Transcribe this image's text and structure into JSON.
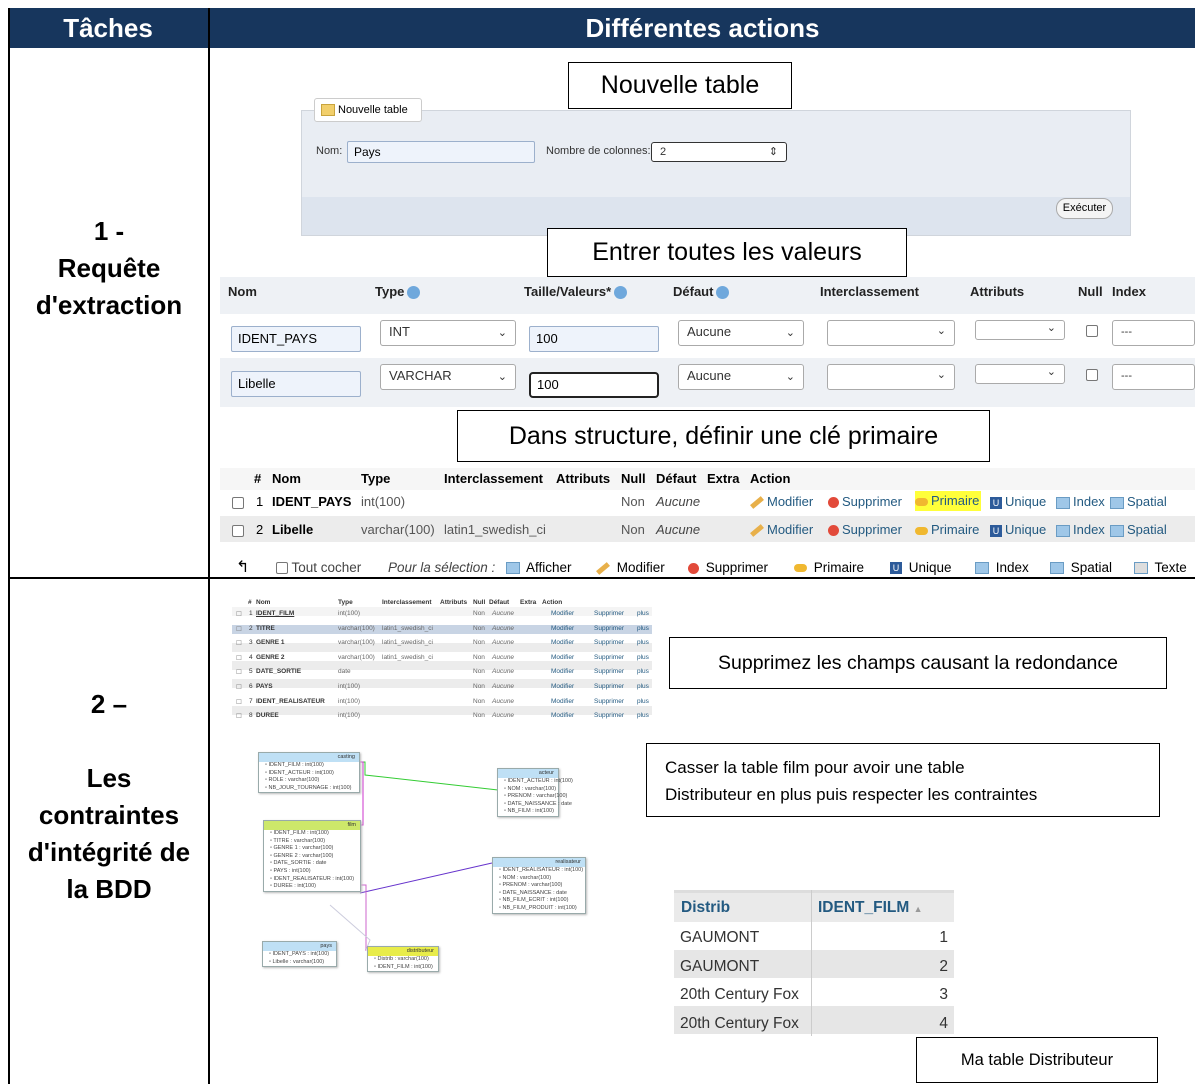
{
  "header": {
    "col1": "Tâches",
    "col2": "Différentes actions"
  },
  "tasks": {
    "task1": [
      "1 -",
      "Requête",
      "d'extraction"
    ],
    "task2": [
      "2 –",
      "",
      "Les",
      "contraintes",
      "d'intégrité de",
      "la BDD"
    ]
  },
  "callouts": {
    "nouvelle_table": "Nouvelle table",
    "entrer_valeurs": "Entrer toutes les valeurs",
    "structure": "Dans structure, définir une clé primaire",
    "supprimez": "Supprimez les champs causant la redondance",
    "casser_l1": "Casser la table film pour avoir une table",
    "casser_l2": "Distributeur en plus puis respecter les contraintes",
    "ma_table": "Ma table Distributeur"
  },
  "new_table_form": {
    "tab_label": "Nouvelle table",
    "nom_label": "Nom:",
    "nom_value": "Pays",
    "cols_label": "Nombre de colonnes:",
    "cols_value": "2",
    "execute": "Exécuter"
  },
  "columns_form": {
    "headers": [
      "Nom",
      "Type",
      "Taille/Valeurs*",
      "Défaut",
      "Interclassement",
      "Attributs",
      "Null",
      "Index"
    ],
    "rows": [
      {
        "name": "IDENT_PAYS",
        "type": "INT",
        "size": "100",
        "default": "Aucune",
        "index": "---"
      },
      {
        "name": "Libelle",
        "type": "VARCHAR",
        "size": "100",
        "default": "Aucune",
        "index": "---"
      }
    ]
  },
  "structure_table": {
    "headers": [
      "#",
      "Nom",
      "Type",
      "Interclassement",
      "Attributs",
      "Null",
      "Défaut",
      "Extra",
      "Action"
    ],
    "rows": [
      {
        "n": "1",
        "name": "IDENT_PAYS",
        "type": "int(100)",
        "coll": "",
        "null": "Non",
        "default": "Aucune"
      },
      {
        "n": "2",
        "name": "Libelle",
        "type": "varchar(100)",
        "coll": "latin1_swedish_ci",
        "null": "Non",
        "default": "Aucune"
      }
    ],
    "actions": [
      "Modifier",
      "Supprimer",
      "Primaire",
      "Unique",
      "Index",
      "Spatial"
    ],
    "footer": {
      "check_all": "Tout cocher",
      "for_selection": "Pour la sélection :",
      "items": [
        "Afficher",
        "Modifier",
        "Supprimer",
        "Primaire",
        "Unique",
        "Index",
        "Spatial",
        "Texte"
      ]
    }
  },
  "film_structure": {
    "headers": [
      "#",
      "Nom",
      "Type",
      "Interclassement",
      "Attributs",
      "Null",
      "Défaut",
      "Extra",
      "Action"
    ],
    "rows": [
      {
        "n": "1",
        "name": "IDENT_FILM",
        "type": "int(100)",
        "coll": ""
      },
      {
        "n": "2",
        "name": "TITRE",
        "type": "varchar(100)",
        "coll": "latin1_swedish_ci"
      },
      {
        "n": "3",
        "name": "GENRE 1",
        "type": "varchar(100)",
        "coll": "latin1_swedish_ci"
      },
      {
        "n": "4",
        "name": "GENRE 2",
        "type": "varchar(100)",
        "coll": "latin1_swedish_ci"
      },
      {
        "n": "5",
        "name": "DATE_SORTIE",
        "type": "date",
        "coll": ""
      },
      {
        "n": "6",
        "name": "PAYS",
        "type": "int(100)",
        "coll": ""
      },
      {
        "n": "7",
        "name": "IDENT_REALISATEUR",
        "type": "int(100)",
        "coll": ""
      },
      {
        "n": "8",
        "name": "DUREE",
        "type": "int(100)",
        "coll": ""
      }
    ],
    "null": "Non",
    "default": "Aucune",
    "act_modifier": "Modifier",
    "act_supprimer": "Supprimer",
    "act_plus": "plus"
  },
  "er_tables": {
    "casting": {
      "title": "casting",
      "rows": [
        "IDENT_FILM : int(100)",
        "IDENT_ACTEUR : int(100)",
        "ROLE : varchar(100)",
        "NB_JOUR_TOURNAGE : int(100)"
      ]
    },
    "acteur": {
      "title": "acteur",
      "rows": [
        "IDENT_ACTEUR : int(100)",
        "NOM : varchar(100)",
        "PRENOM : varchar(100)",
        "DATE_NAISSANCE : date",
        "NB_FILM : int(100)"
      ]
    },
    "film": {
      "title": "film",
      "rows": [
        "IDENT_FILM : int(100)",
        "TITRE : varchar(100)",
        "GENRE 1 : varchar(100)",
        "GENRE 2 : varchar(100)",
        "DATE_SORTIE : date",
        "PAYS : int(100)",
        "IDENT_REALISATEUR : int(100)",
        "DUREE : int(100)"
      ]
    },
    "realisateur": {
      "title": "realisateur",
      "rows": [
        "IDENT_REALISATEUR : int(100)",
        "NOM : varchar(100)",
        "PRENOM : varchar(100)",
        "DATE_NAISSANCE : date",
        "NB_FILM_ECRIT : int(100)",
        "NB_FILM_PRODUIT : int(100)"
      ]
    },
    "pays": {
      "title": "pays",
      "rows": [
        "IDENT_PAYS : int(100)",
        "Libelle : varchar(100)"
      ]
    },
    "distributeur": {
      "title": "distributeur",
      "rows": [
        "Distrib : varchar(100)",
        "IDENT_FILM : int(100)"
      ]
    }
  },
  "distrib_table": {
    "headers": [
      "Distrib",
      "IDENT_FILM"
    ],
    "rows": [
      [
        "GAUMONT",
        "1"
      ],
      [
        "GAUMONT",
        "2"
      ],
      [
        "20th Century Fox",
        "3"
      ],
      [
        "20th Century Fox",
        "4"
      ]
    ]
  }
}
